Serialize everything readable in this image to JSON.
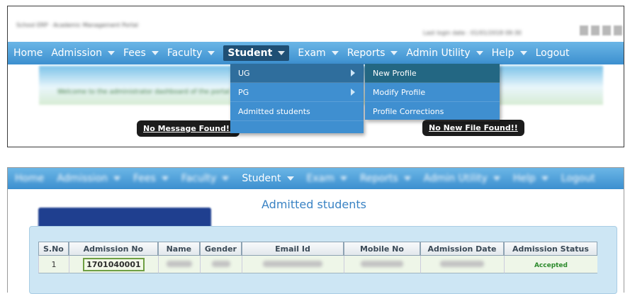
{
  "top_panel": {
    "title_text": "School ERP · Academic Management Portal",
    "user_info": "Last login date : 01/01/2018 09:30",
    "menu": [
      {
        "label": "Home",
        "arrow": false
      },
      {
        "label": "Admission",
        "arrow": true
      },
      {
        "label": "Fees",
        "arrow": true
      },
      {
        "label": "Faculty",
        "arrow": true
      },
      {
        "label": "Student",
        "arrow": true,
        "active": true
      },
      {
        "label": "Exam",
        "arrow": true
      },
      {
        "label": "Reports",
        "arrow": true
      },
      {
        "label": "Admin Utility",
        "arrow": true
      },
      {
        "label": "Help",
        "arrow": true
      },
      {
        "label": "Logout",
        "arrow": false
      }
    ],
    "banner_text": "Welcome to the administrator dashboard of the portal",
    "message_pill": "No Message Found!!",
    "file_pill": "No New File Found!!",
    "student_dropdown": [
      {
        "label": "UG",
        "submenu": true,
        "selected": true
      },
      {
        "label": "PG",
        "submenu": true,
        "selected": false
      },
      {
        "label": "Admitted students",
        "submenu": false,
        "selected": false
      }
    ],
    "ug_submenu": [
      {
        "label": "New Profile",
        "selected": true
      },
      {
        "label": "Modify Profile",
        "selected": false
      },
      {
        "label": "Profile Corrections",
        "selected": false
      }
    ]
  },
  "bottom_panel": {
    "menu": [
      {
        "label": "Home",
        "arrow": false,
        "blurred": true
      },
      {
        "label": "Admission",
        "arrow": true,
        "blurred": true
      },
      {
        "label": "Fees",
        "arrow": true,
        "blurred": true
      },
      {
        "label": "Faculty",
        "arrow": true,
        "blurred": true
      },
      {
        "label": "Student",
        "arrow": true,
        "blurred": false
      },
      {
        "label": "Exam",
        "arrow": true,
        "blurred": true
      },
      {
        "label": "Reports",
        "arrow": true,
        "blurred": true
      },
      {
        "label": "Admin Utility",
        "arrow": true,
        "blurred": true
      },
      {
        "label": "Help",
        "arrow": true,
        "blurred": true
      },
      {
        "label": "Logout",
        "arrow": false,
        "blurred": true
      }
    ],
    "heading": "Admitted students",
    "table": {
      "headers": [
        "S.No",
        "Admission No",
        "Name",
        "Gender",
        "Email Id",
        "Mobile No",
        "Admission Date",
        "Admission Status"
      ],
      "rows": [
        {
          "sno": "1",
          "admission_no": "1701040001",
          "name": "",
          "gender": "",
          "email": "",
          "mobile": "",
          "date": "",
          "status": "Accepted"
        }
      ]
    }
  },
  "colors": {
    "menubar_top": "#6bb6e6",
    "menubar_bottom": "#3c8fcf",
    "dropdown_bg": "#3f8fd0",
    "accent_heading": "#3a83c4",
    "status_accepted": "#2c8a2c"
  }
}
